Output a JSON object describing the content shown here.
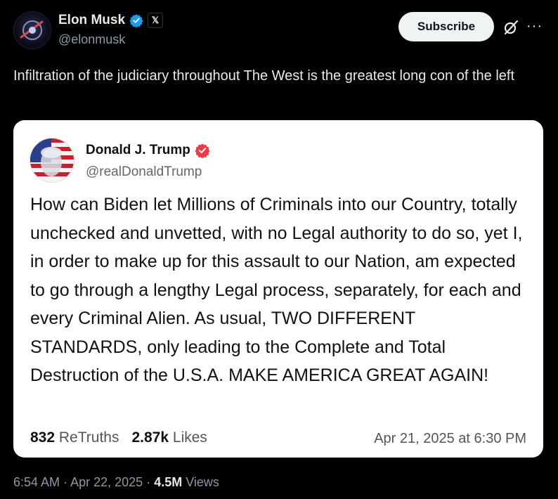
{
  "author": {
    "name": "Elon Musk",
    "handle": "@elonmusk",
    "affiliate_badge": "𝕏"
  },
  "actions": {
    "subscribe_label": "Subscribe",
    "more_label": "···"
  },
  "tweet": {
    "text": "Infiltration of the judiciary throughout The West is the greatest long con of the left"
  },
  "quoted_post": {
    "name": "Donald J. Trump",
    "handle": "@realDonaldTrump",
    "body": "How can Biden let Millions of Criminals into our Country, totally unchecked and unvetted, with no Legal authority to do so, yet I, in order to make up for this assault to our Nation, am expected to go through a lengthy Legal process, separately, for each and every Criminal Alien. As usual, TWO DIFFERENT STANDARDS, only leading to the Complete and Total Destruction of the U.S.A. MAKE AMERICA GREAT AGAIN!",
    "retruths_count": "832",
    "retruths_label": "ReTruths",
    "likes_count": "2.87k",
    "likes_label": "Likes",
    "date": "Apr 21, 2025 at 6:30 PM"
  },
  "meta": {
    "time": "6:54 AM",
    "sep1": "·",
    "date": "Apr 22, 2025",
    "sep2": "·",
    "views_count": "4.5M",
    "views_label": "Views"
  },
  "colors": {
    "background": "#000000",
    "verified_blue": "#1d9bf0",
    "truth_badge": "#ee3a43",
    "card_background": "#ffffff"
  },
  "icons": {
    "verified": "verified-check-icon",
    "grok": "grok-icon",
    "more": "more-icon",
    "truth_verified": "truth-verified-icon"
  }
}
